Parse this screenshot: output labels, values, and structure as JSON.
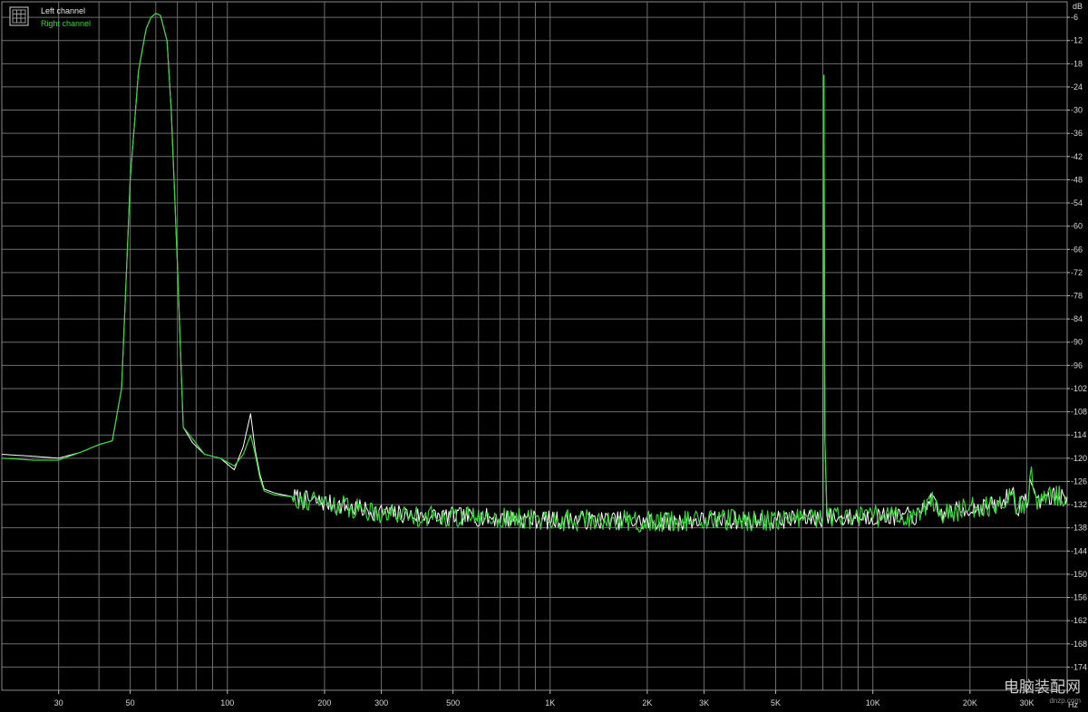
{
  "watermark": {
    "text": "电脑装配网",
    "url": "dnzp.com"
  },
  "colors": {
    "background": "#000000",
    "grid": "#6e6e6e",
    "left": "#ffffff",
    "right": "#39d43a",
    "text": "#d8d8d8"
  },
  "chart_data": {
    "type": "line",
    "title": "",
    "xlabel": "Hz",
    "ylabel": "dB",
    "xscale": "log",
    "xlim": [
      20,
      40000
    ],
    "ylim": [
      -180,
      -2
    ],
    "grid": true,
    "legend_position": "top-left",
    "x_ticks": [
      {
        "value": 30,
        "label": "30"
      },
      {
        "value": 50,
        "label": "50"
      },
      {
        "value": 100,
        "label": "100"
      },
      {
        "value": 200,
        "label": "200"
      },
      {
        "value": 300,
        "label": "300"
      },
      {
        "value": 500,
        "label": "500"
      },
      {
        "value": 1000,
        "label": "1K"
      },
      {
        "value": 2000,
        "label": "2K"
      },
      {
        "value": 3000,
        "label": "3K"
      },
      {
        "value": 5000,
        "label": "5K"
      },
      {
        "value": 10000,
        "label": "10K"
      },
      {
        "value": 20000,
        "label": "20K"
      },
      {
        "value": 30000,
        "label": "30K"
      }
    ],
    "y_ticks": [
      -6,
      -12,
      -18,
      -24,
      -30,
      -36,
      -42,
      -48,
      -54,
      -60,
      -66,
      -72,
      -78,
      -84,
      -90,
      -96,
      -102,
      -108,
      -114,
      -120,
      -126,
      -132,
      -138,
      -144,
      -150,
      -156,
      -162,
      -168,
      -174
    ],
    "series": [
      {
        "name": "Left channel",
        "color": "#ffffff",
        "x": [
          20,
          25,
          30,
          35,
          40,
          44,
          47,
          50,
          53,
          56,
          58,
          60,
          62,
          65,
          67,
          70,
          73,
          78,
          85,
          95,
          105,
          112,
          118,
          122,
          126,
          130,
          140,
          160,
          180,
          200,
          250,
          300,
          400,
          500,
          700,
          1000,
          1500,
          2000,
          3000,
          5000,
          6500,
          7000,
          7050,
          7100,
          7200,
          8000,
          10000,
          14000,
          15000,
          16000,
          20000,
          25000,
          27000,
          28000,
          30000,
          31000,
          32000,
          35000,
          40000
        ],
        "y": [
          -119,
          -119.5,
          -120,
          -118.5,
          -116.5,
          -115.5,
          -102,
          -48,
          -20,
          -9,
          -6,
          -5,
          -5.5,
          -12,
          -30,
          -70,
          -112,
          -116,
          -119,
          -120,
          -123,
          -117,
          -108.5,
          -118,
          -124,
          -128,
          -129,
          -130,
          -131,
          -131.5,
          -133,
          -134,
          -135,
          -135,
          -135.5,
          -136,
          -136,
          -136.5,
          -136,
          -136,
          -135.5,
          -135.5,
          -21,
          -115,
          -135,
          -135.5,
          -135,
          -135,
          -130,
          -134.5,
          -133,
          -132,
          -128,
          -133,
          -131,
          -125,
          -131,
          -130,
          -130
        ]
      },
      {
        "name": "Right channel",
        "color": "#39d43a",
        "x": [
          20,
          25,
          30,
          35,
          40,
          44,
          47,
          50,
          53,
          56,
          58,
          60,
          62,
          65,
          67,
          70,
          73,
          78,
          85,
          95,
          105,
          112,
          118,
          122,
          126,
          130,
          140,
          160,
          180,
          200,
          250,
          300,
          400,
          500,
          700,
          1000,
          1500,
          2000,
          3000,
          5000,
          6500,
          7000,
          7050,
          7100,
          7200,
          8000,
          10000,
          14000,
          15000,
          16000,
          20000,
          25000,
          27000,
          28000,
          30000,
          31000,
          32000,
          35000,
          40000
        ],
        "y": [
          -120,
          -120.5,
          -120.5,
          -118.5,
          -116.5,
          -115.5,
          -102,
          -48,
          -20,
          -9,
          -6,
          -5,
          -5.5,
          -12,
          -30,
          -70,
          -112,
          -115,
          -119,
          -120,
          -122,
          -119,
          -114,
          -119,
          -125,
          -128.5,
          -129.5,
          -130,
          -131,
          -131.5,
          -133,
          -134,
          -135,
          -135,
          -135.5,
          -136,
          -136,
          -136.5,
          -136,
          -136,
          -135.5,
          -135.5,
          -21,
          -115,
          -135,
          -135.5,
          -135,
          -135,
          -130,
          -134.5,
          -133,
          -132,
          -128,
          -133,
          -131,
          -125,
          -131,
          -130,
          -130
        ]
      }
    ]
  }
}
